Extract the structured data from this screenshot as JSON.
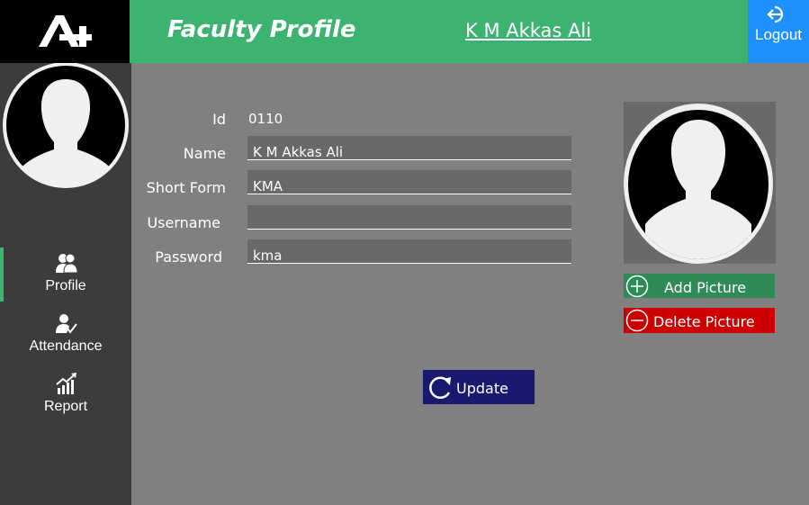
{
  "header": {
    "title": "Faculty Profile",
    "user_name": "K M Akkas Ali",
    "logout_label": "Logout"
  },
  "sidebar": {
    "items": [
      {
        "label": "Profile",
        "icon": "users-icon",
        "active": true
      },
      {
        "label": "Attendance",
        "icon": "user-check-icon",
        "active": false
      },
      {
        "label": "Report",
        "icon": "chart-icon",
        "active": false
      }
    ]
  },
  "form": {
    "id_label": "Id",
    "id_value": "0110",
    "name_label": "Name",
    "name_value": "K M Akkas Ali",
    "short_label": "Short Form",
    "short_value": "KMA",
    "username_label": "Username",
    "username_value": "",
    "password_label": "Password",
    "password_value": "kma"
  },
  "picture": {
    "add_label": "Add Picture",
    "delete_label": "Delete Picture"
  },
  "update_label": "Update",
  "colors": {
    "header_green": "#3cb371",
    "logout_blue": "#1e90ff",
    "sidebar_dark": "#3c3c3c",
    "add_green": "#2e8b57",
    "delete_red": "#cc0000",
    "update_navy": "#191970"
  }
}
